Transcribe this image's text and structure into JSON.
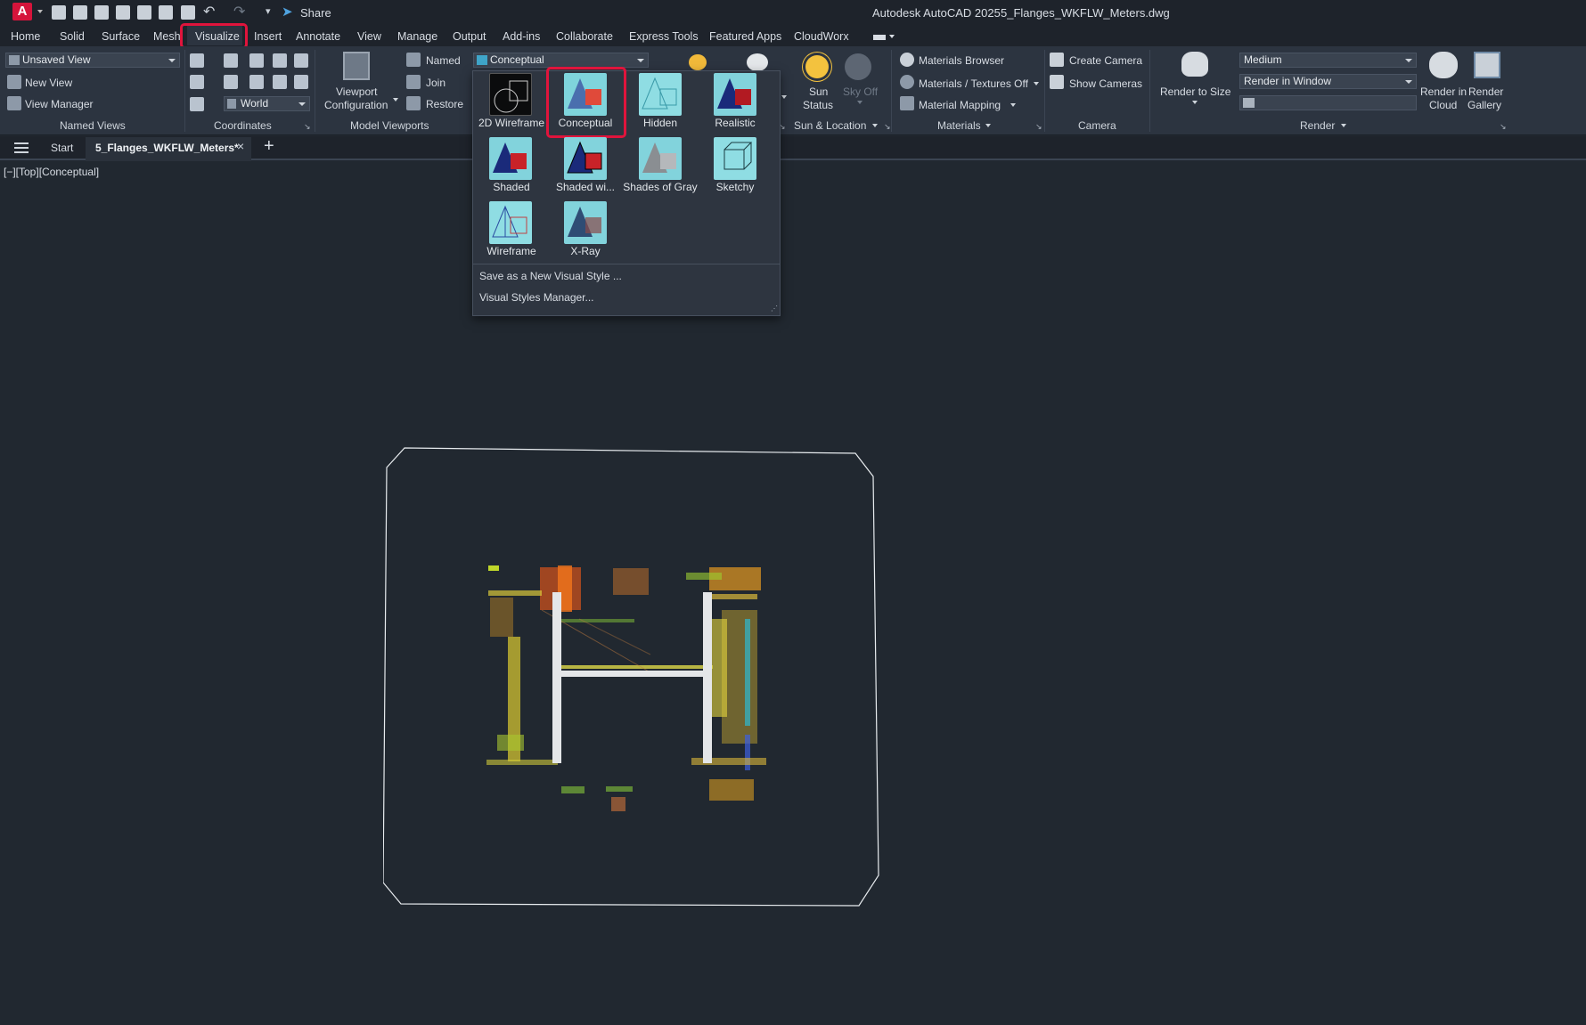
{
  "app": {
    "title": "Autodesk AutoCAD 2025",
    "file": "5_Flanges_WKFLW_Meters.dwg",
    "share": "Share"
  },
  "menu": [
    "Home",
    "Solid",
    "Surface",
    "Mesh",
    "Visualize",
    "Insert",
    "Annotate",
    "View",
    "Manage",
    "Output",
    "Add-ins",
    "Collaborate",
    "Express Tools",
    "Featured Apps",
    "CloudWorx"
  ],
  "ribbon": {
    "named_views": {
      "combo": "Unsaved View",
      "new_view": "New View",
      "view_manager": "View Manager",
      "label": "Named Views"
    },
    "coordinates": {
      "combo": "World",
      "label": "Coordinates"
    },
    "model_viewports": {
      "viewport_config_1": "Viewport",
      "viewport_config_2": "Configuration",
      "named": "Named",
      "join": "Join",
      "restore": "Restore",
      "label": "Model Viewports"
    },
    "visual_styles": {
      "combo": "Conceptual"
    },
    "sun": {
      "sun_status_1": "Sun",
      "sun_status_2": "Status",
      "sky_off": "Sky Off",
      "label": "Sun & Location"
    },
    "materials": {
      "browser": "Materials Browser",
      "textures": "Materials / Textures Off",
      "mapping": "Material Mapping",
      "label": "Materials"
    },
    "camera": {
      "create": "Create Camera",
      "show": "Show Cameras",
      "label": "Camera"
    },
    "render": {
      "render_to_size_1": "Render to Size",
      "quality": "Medium",
      "output": "Render in Window",
      "cloud_1": "Render in",
      "cloud_2": "Cloud",
      "gallery_1": "Render",
      "gallery_2": "Gallery",
      "label": "Render"
    }
  },
  "visual_styles_menu": {
    "styles": [
      "2D Wireframe",
      "Conceptual",
      "Hidden",
      "Realistic",
      "Shaded",
      "Shaded wi...",
      "Shades of Gray",
      "Sketchy",
      "Wireframe",
      "X-Ray"
    ],
    "save_as": "Save as a New Visual Style ...",
    "manager": "Visual Styles Manager..."
  },
  "tabs": {
    "start": "Start",
    "active": "5_Flanges_WKFLW_Meters*"
  },
  "viewport_label": "[−][Top][Conceptual]",
  "colors": {
    "highlight": "#e0143c",
    "bg": "#212830",
    "ribbon": "#2c3440"
  }
}
